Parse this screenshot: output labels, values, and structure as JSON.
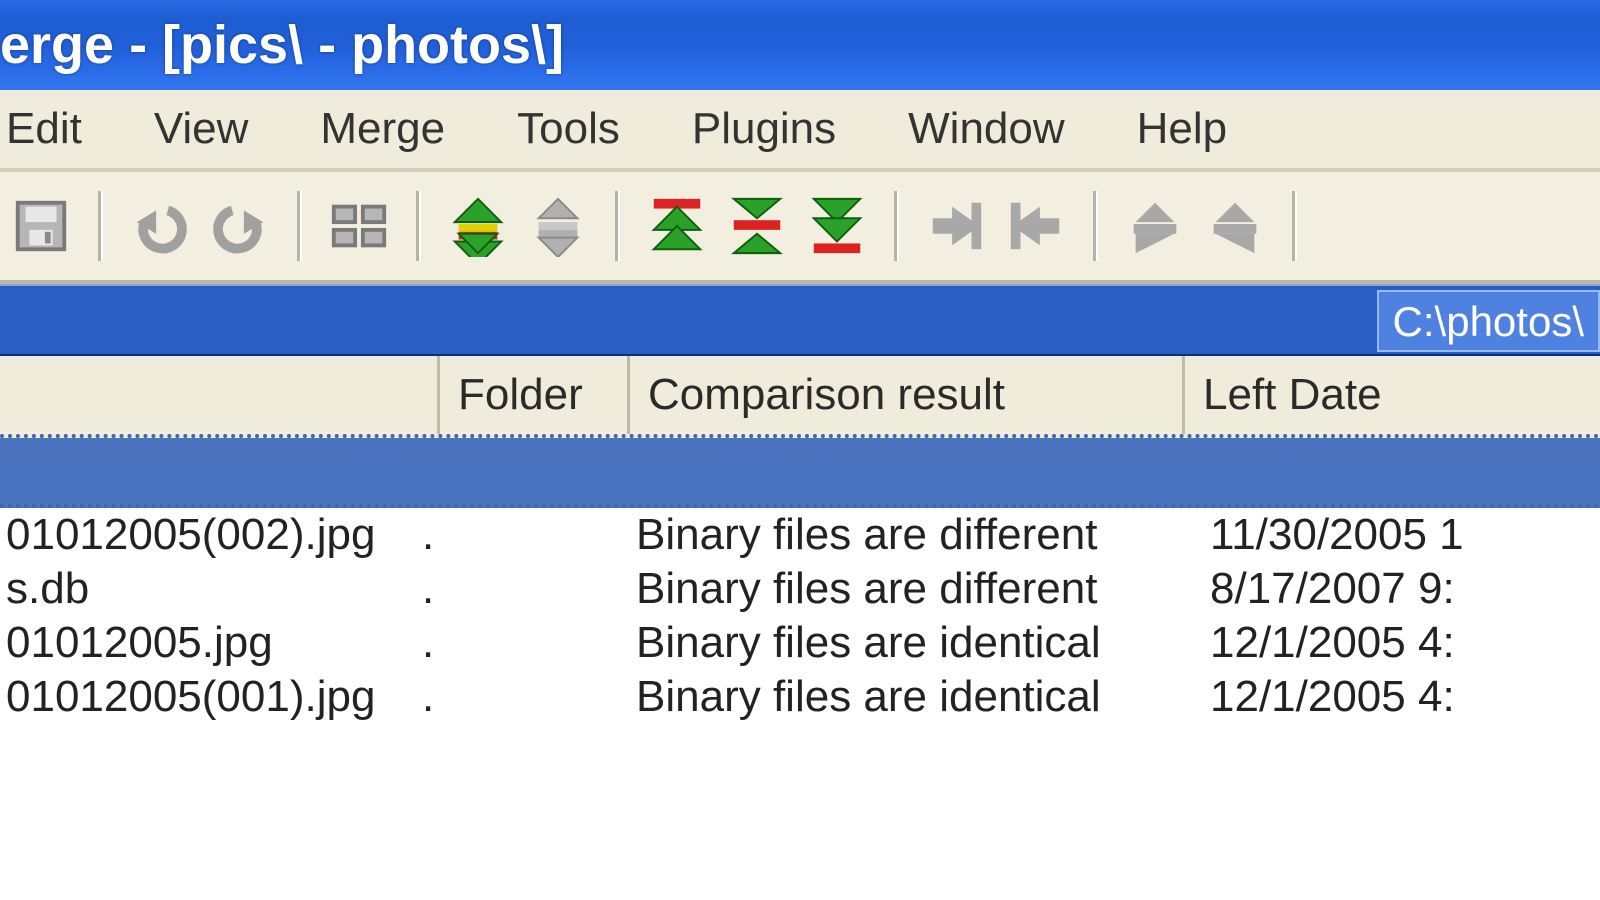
{
  "window": {
    "title": "erge - [pics\\ - photos\\]"
  },
  "menu": {
    "items": [
      "Edit",
      "View",
      "Merge",
      "Tools",
      "Plugins",
      "Window",
      "Help"
    ]
  },
  "toolbar": {
    "save": "save-icon",
    "undo": "undo-icon",
    "redo": "redo-icon",
    "layout": "layout-icon",
    "diff_down": "diff-next-icon",
    "diff_up": "diff-prev-icon",
    "to_first": "to-first-diff-icon",
    "to_current": "to-current-diff-icon",
    "to_last": "to-last-diff-icon",
    "copy_right": "copy-right-icon",
    "copy_left": "copy-left-icon",
    "merge_left": "merge-to-left-icon",
    "merge_right": "merge-to-right-icon"
  },
  "path": {
    "right": "C:\\photos\\"
  },
  "columns": {
    "filename": "",
    "folder": "Folder",
    "result": "Comparison result",
    "date": "Left Date"
  },
  "rows": [
    {
      "name": "01012005(002).jpg",
      "folder": ".",
      "result": "Binary files are different",
      "date": "11/30/2005 1"
    },
    {
      "name": "s.db",
      "folder": ".",
      "result": "Binary files are different",
      "date": "8/17/2007 9:"
    },
    {
      "name": "01012005.jpg",
      "folder": ".",
      "result": "Binary files are identical",
      "date": "12/1/2005 4:"
    },
    {
      "name": "01012005(001).jpg",
      "folder": ".",
      "result": "Binary files are identical",
      "date": "12/1/2005 4:"
    }
  ]
}
